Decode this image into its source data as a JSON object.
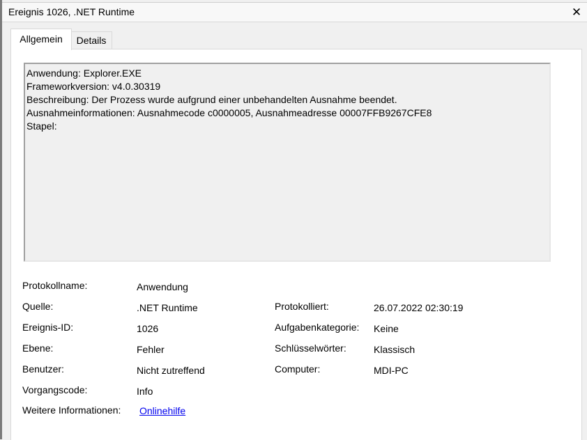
{
  "window": {
    "title": "Ereignis 1026, .NET Runtime",
    "close_symbol": "✕"
  },
  "tabs": [
    {
      "label": "Allgemein",
      "active": true
    },
    {
      "label": "Details",
      "active": false
    }
  ],
  "description": {
    "lines": [
      "Anwendung: Explorer.EXE",
      "Frameworkversion: v4.0.30319",
      "Beschreibung: Der Prozess wurde aufgrund einer unbehandelten Ausnahme beendet.",
      "Ausnahmeinformationen: Ausnahmecode c0000005, Ausnahmeadresse 00007FFB9267CFE8",
      "Stapel:"
    ]
  },
  "properties": {
    "protokollname": {
      "label": "Protokollname:",
      "value": "Anwendung"
    },
    "quelle": {
      "label": "Quelle:",
      "value": ".NET Runtime"
    },
    "ereignis_id": {
      "label": "Ereignis-ID:",
      "value": "1026"
    },
    "ebene": {
      "label": "Ebene:",
      "value": "Fehler"
    },
    "benutzer": {
      "label": "Benutzer:",
      "value": "Nicht zutreffend"
    },
    "vorgangscode": {
      "label": "Vorgangscode:",
      "value": "Info"
    },
    "weitere_informationen": {
      "label": "Weitere Informationen:",
      "link": "Onlinehilfe"
    },
    "protokolliert": {
      "label": "Protokolliert:",
      "value": "26.07.2022 02:30:19"
    },
    "aufgabenkategorie": {
      "label": "Aufgabenkategorie:",
      "value": "Keine"
    },
    "schluesselwoerter": {
      "label": "Schlüsselwörter:",
      "value": "Klassisch"
    },
    "computer": {
      "label": "Computer:",
      "value": "MDI-PC"
    }
  },
  "colors": {
    "link": "#0000ee",
    "panel": "#ffffff",
    "dialog": "#f0f0f0"
  }
}
